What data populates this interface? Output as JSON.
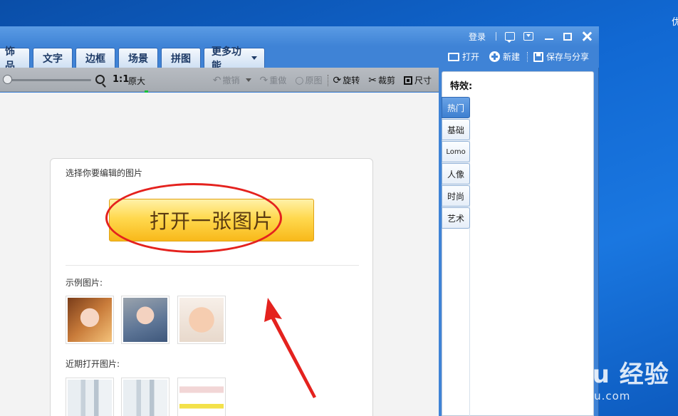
{
  "desktop": {
    "corner_glyph": "优"
  },
  "titlebar": {
    "login": "登录"
  },
  "tabs": [
    "饰品",
    "文字",
    "边框",
    "场景",
    "拼图"
  ],
  "more_tab": "更多功能",
  "file_actions": {
    "open": "打开",
    "new": "新建",
    "save_share": "保存与分享"
  },
  "toolbar": {
    "ratio": "1:1",
    "original_size": "原大",
    "undo": "撤销",
    "redo": "重做",
    "original": "原图",
    "rotate": "旋转",
    "crop": "裁剪",
    "size": "尺寸"
  },
  "open_panel": {
    "heading": "选择你要编辑的图片",
    "open_button": "打开一张图片",
    "examples_label": "示例图片:",
    "recent_label": "近期打开图片:"
  },
  "effects": {
    "title": "特效:",
    "tabs": [
      "热门",
      "基础",
      "Lomo",
      "人像",
      "时尚",
      "艺术"
    ]
  },
  "watermark": {
    "logo": "Bai du 经验",
    "site": "jingyan.baidu.com"
  },
  "colors": {
    "accent": "#3f83d6",
    "highlight": "#e4221e",
    "button_yellow": "#ffd94f"
  }
}
